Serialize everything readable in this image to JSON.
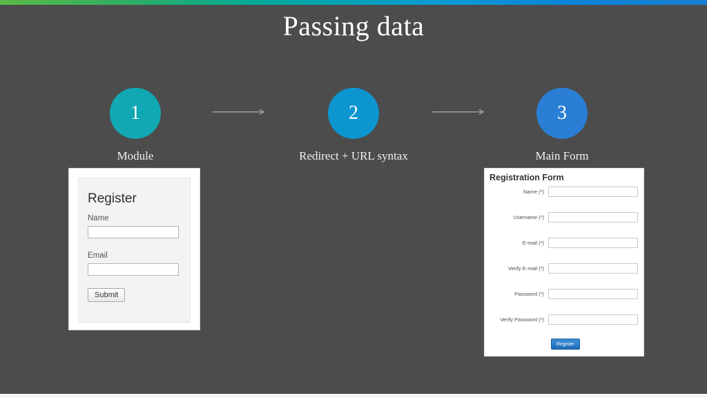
{
  "slide": {
    "title": "Passing data",
    "title_dots": "· · ·",
    "background_color": "#4c4c4c",
    "gradient_bar": {
      "start_color": "#5cb947",
      "mid_color": "#00a99d",
      "end_color": "#1a7fd4"
    }
  },
  "steps": [
    {
      "number": "1",
      "label": "Module",
      "color": "#11a8b3"
    },
    {
      "number": "2",
      "label": "Redirect + URL syntax",
      "color": "#0d95d0"
    },
    {
      "number": "3",
      "label": "Main Form",
      "color": "#2a7fd4"
    }
  ],
  "arrows": [
    {
      "name": "arrow-step1-to-step2",
      "color": "#b0b0b0"
    },
    {
      "name": "arrow-step2-to-step3",
      "color": "#b0b0b0"
    }
  ],
  "left_form": {
    "heading": "Register",
    "fields": [
      {
        "label": "Name",
        "value": "",
        "placeholder": ""
      },
      {
        "label": "Email",
        "value": "",
        "placeholder": ""
      }
    ],
    "submit_label": "Submit"
  },
  "right_form": {
    "heading": "Registration Form",
    "fields": [
      {
        "label": "Name (*)",
        "value": "",
        "placeholder": ""
      },
      {
        "label": "Username (*)",
        "value": "",
        "placeholder": ""
      },
      {
        "label": "E-mail (*)",
        "value": "",
        "placeholder": ""
      },
      {
        "label": "Verify E-mail (*)",
        "value": "",
        "placeholder": ""
      },
      {
        "label": "Password (*)",
        "value": "",
        "placeholder": ""
      },
      {
        "label": "Verify Password (*)",
        "value": "",
        "placeholder": ""
      }
    ],
    "submit_label": "Register",
    "submit_color": "#2a7ac0"
  }
}
